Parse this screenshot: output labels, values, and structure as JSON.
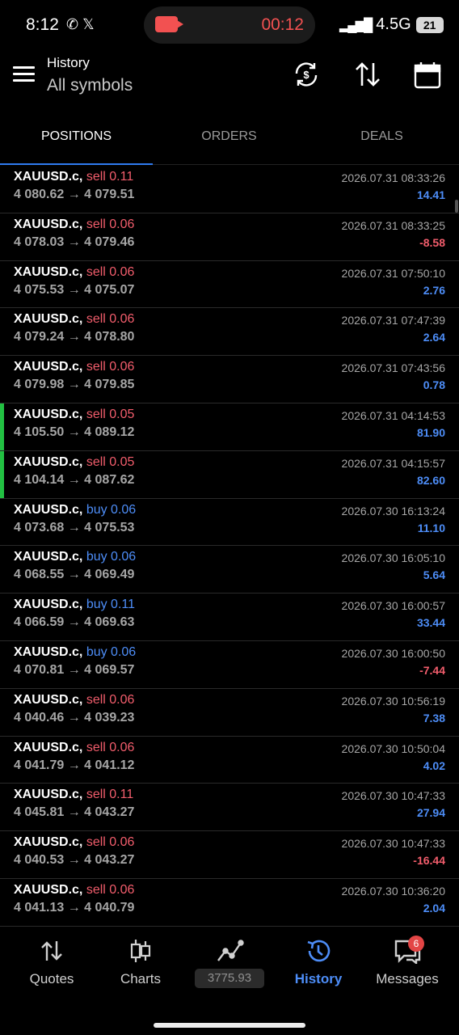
{
  "status_bar": {
    "time": "8:12",
    "left_icons": "✆ 𝕏",
    "recording_time": "00:12",
    "network": "4.5G",
    "battery": "21"
  },
  "header": {
    "title": "History",
    "subtitle": "All symbols"
  },
  "tabs": [
    {
      "label": "POSITIONS",
      "active": true
    },
    {
      "label": "ORDERS",
      "active": false
    },
    {
      "label": "DEALS",
      "active": false
    }
  ],
  "deals": [
    {
      "symbol": "XAUUSD.c,",
      "direction": "sell 0.11",
      "type": "sell",
      "prices": "4 080.62 → 4 079.51",
      "date": "2026.07.31 08:33:26",
      "profit": "14.41",
      "profit_sign": "pos",
      "marked": false
    },
    {
      "symbol": "XAUUSD.c,",
      "direction": "sell 0.06",
      "type": "sell",
      "prices": "4 078.03 → 4 079.46",
      "date": "2026.07.31 08:33:25",
      "profit": "-8.58",
      "profit_sign": "neg",
      "marked": false
    },
    {
      "symbol": "XAUUSD.c,",
      "direction": "sell 0.06",
      "type": "sell",
      "prices": "4 075.53 → 4 075.07",
      "date": "2026.07.31 07:50:10",
      "profit": "2.76",
      "profit_sign": "pos",
      "marked": false
    },
    {
      "symbol": "XAUUSD.c,",
      "direction": "sell 0.06",
      "type": "sell",
      "prices": "4 079.24 → 4 078.80",
      "date": "2026.07.31 07:47:39",
      "profit": "2.64",
      "profit_sign": "pos",
      "marked": false
    },
    {
      "symbol": "XAUUSD.c,",
      "direction": "sell 0.06",
      "type": "sell",
      "prices": "4 079.98 → 4 079.85",
      "date": "2026.07.31 07:43:56",
      "profit": "0.78",
      "profit_sign": "pos",
      "marked": false
    },
    {
      "symbol": "XAUUSD.c,",
      "direction": "sell 0.05",
      "type": "sell",
      "prices": "4 105.50 → 4 089.12",
      "date": "2026.07.31 04:14:53",
      "profit": "81.90",
      "profit_sign": "pos",
      "marked": true
    },
    {
      "symbol": "XAUUSD.c,",
      "direction": "sell 0.05",
      "type": "sell",
      "prices": "4 104.14 → 4 087.62",
      "date": "2026.07.31 04:15:57",
      "profit": "82.60",
      "profit_sign": "pos",
      "marked": true
    },
    {
      "symbol": "XAUUSD.c,",
      "direction": "buy 0.06",
      "type": "buy",
      "prices": "4 073.68 → 4 075.53",
      "date": "2026.07.30 16:13:24",
      "profit": "11.10",
      "profit_sign": "pos",
      "marked": false
    },
    {
      "symbol": "XAUUSD.c,",
      "direction": "buy 0.06",
      "type": "buy",
      "prices": "4 068.55 → 4 069.49",
      "date": "2026.07.30 16:05:10",
      "profit": "5.64",
      "profit_sign": "pos",
      "marked": false
    },
    {
      "symbol": "XAUUSD.c,",
      "direction": "buy 0.11",
      "type": "buy",
      "prices": "4 066.59 → 4 069.63",
      "date": "2026.07.30 16:00:57",
      "profit": "33.44",
      "profit_sign": "pos",
      "marked": false
    },
    {
      "symbol": "XAUUSD.c,",
      "direction": "buy 0.06",
      "type": "buy",
      "prices": "4 070.81 → 4 069.57",
      "date": "2026.07.30 16:00:50",
      "profit": "-7.44",
      "profit_sign": "neg",
      "marked": false
    },
    {
      "symbol": "XAUUSD.c,",
      "direction": "sell 0.06",
      "type": "sell",
      "prices": "4 040.46 → 4 039.23",
      "date": "2026.07.30 10:56:19",
      "profit": "7.38",
      "profit_sign": "pos",
      "marked": false
    },
    {
      "symbol": "XAUUSD.c,",
      "direction": "sell 0.06",
      "type": "sell",
      "prices": "4 041.79 → 4 041.12",
      "date": "2026.07.30 10:50:04",
      "profit": "4.02",
      "profit_sign": "pos",
      "marked": false
    },
    {
      "symbol": "XAUUSD.c,",
      "direction": "sell 0.11",
      "type": "sell",
      "prices": "4 045.81 → 4 043.27",
      "date": "2026.07.30 10:47:33",
      "profit": "27.94",
      "profit_sign": "pos",
      "marked": false
    },
    {
      "symbol": "XAUUSD.c,",
      "direction": "sell 0.06",
      "type": "sell",
      "prices": "4 040.53 → 4 043.27",
      "date": "2026.07.30 10:47:33",
      "profit": "-16.44",
      "profit_sign": "neg",
      "marked": false
    },
    {
      "symbol": "XAUUSD.c,",
      "direction": "sell 0.06",
      "type": "sell",
      "prices": "4 041.13 → 4 040.79",
      "date": "2026.07.30 10:36:20",
      "profit": "2.04",
      "profit_sign": "pos",
      "marked": false
    }
  ],
  "bottom_nav": {
    "items": [
      {
        "label": "Quotes",
        "icon": "arrows-updown-icon"
      },
      {
        "label": "Charts",
        "icon": "candlestick-icon"
      },
      {
        "label": "",
        "icon": "trade-line-icon"
      },
      {
        "label": "History",
        "icon": "history-icon",
        "active": true
      },
      {
        "label": "Messages",
        "icon": "messages-icon"
      }
    ],
    "balance": "3775.93",
    "messages_badge": "6"
  },
  "colors": {
    "accent": "#4d8df7",
    "sell": "#f25d6c",
    "buy": "#4d8df7",
    "marker": "#22c042",
    "recording": "#f25151"
  }
}
